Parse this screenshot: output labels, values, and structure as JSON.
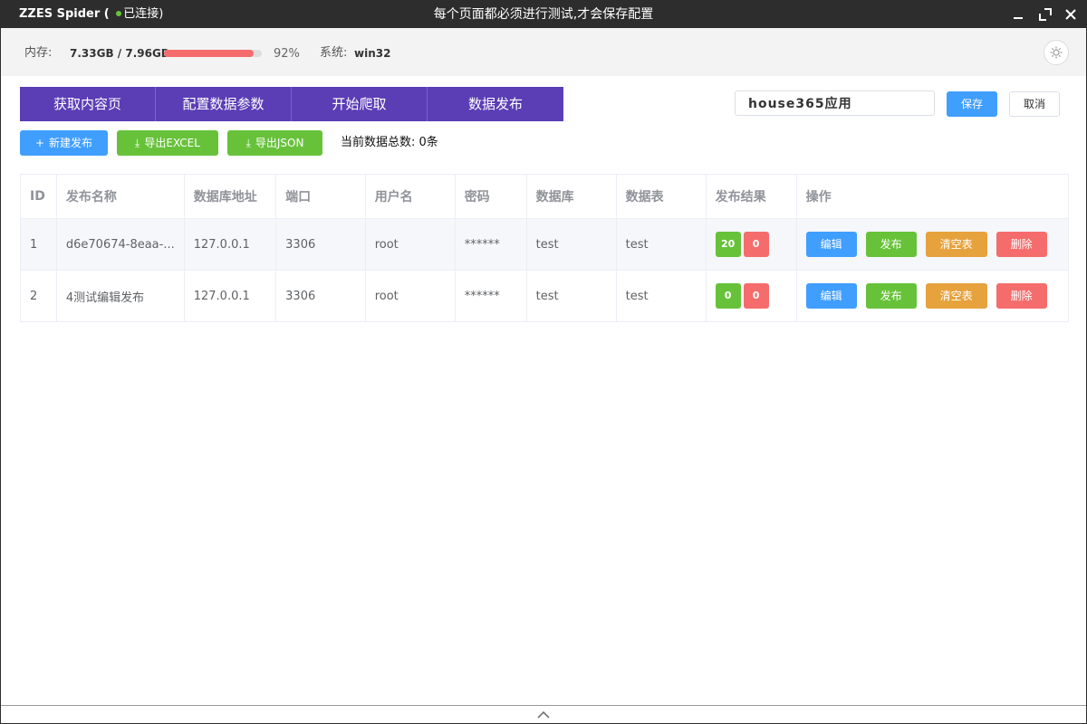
{
  "titlebar": {
    "app_name": "ZZES Spider ( ",
    "connection": "已连接)",
    "notice": "每个页面都必须进行测试,才会保存配置"
  },
  "stats": {
    "memory_label": "内存:",
    "memory_value": "7.33GB / 7.96GB",
    "memory_percent_text": "92%",
    "memory_percent": 92,
    "system_label": "系统:",
    "system_value": "win32"
  },
  "tabs": [
    "获取内容页",
    "配置数据参数",
    "开始爬取",
    "数据发布"
  ],
  "app_name_input": {
    "value": "house365应用"
  },
  "buttons": {
    "save": "保存",
    "cancel": "取消",
    "new": "新建发布",
    "export_excel": "导出EXCEL",
    "export_json": "导出JSON"
  },
  "count_text": "当前数据总数: 0条",
  "table": {
    "headers": [
      "ID",
      "发布名称",
      "数据库地址",
      "端口",
      "用户名",
      "密码",
      "数据库",
      "数据表",
      "发布结果",
      "操作"
    ],
    "rows": [
      {
        "id": "1",
        "name": "d6e70674-8eaa-...",
        "host": "127.0.0.1",
        "port": "3306",
        "user": "root",
        "password": "******",
        "db": "test",
        "table": "test",
        "success": "20",
        "fail": "0"
      },
      {
        "id": "2",
        "name": "4测试编辑发布",
        "host": "127.0.0.1",
        "port": "3306",
        "user": "root",
        "password": "******",
        "db": "test",
        "table": "test",
        "success": "0",
        "fail": "0"
      }
    ],
    "actions": {
      "edit": "编辑",
      "publish": "发布",
      "clear": "清空表",
      "delete": "删除"
    }
  },
  "colors": {
    "titlebar": "#2d2d2d",
    "tab": "#5b3db5",
    "primary": "#409eff",
    "success": "#67c23a",
    "warning": "#e6a23c",
    "danger": "#f56c6c"
  },
  "icons": [
    "connected-dot-icon",
    "minimize-icon",
    "maximize-icon",
    "close-icon",
    "settings-icon",
    "plus-icon",
    "download-icon",
    "chevron-up-icon"
  ]
}
